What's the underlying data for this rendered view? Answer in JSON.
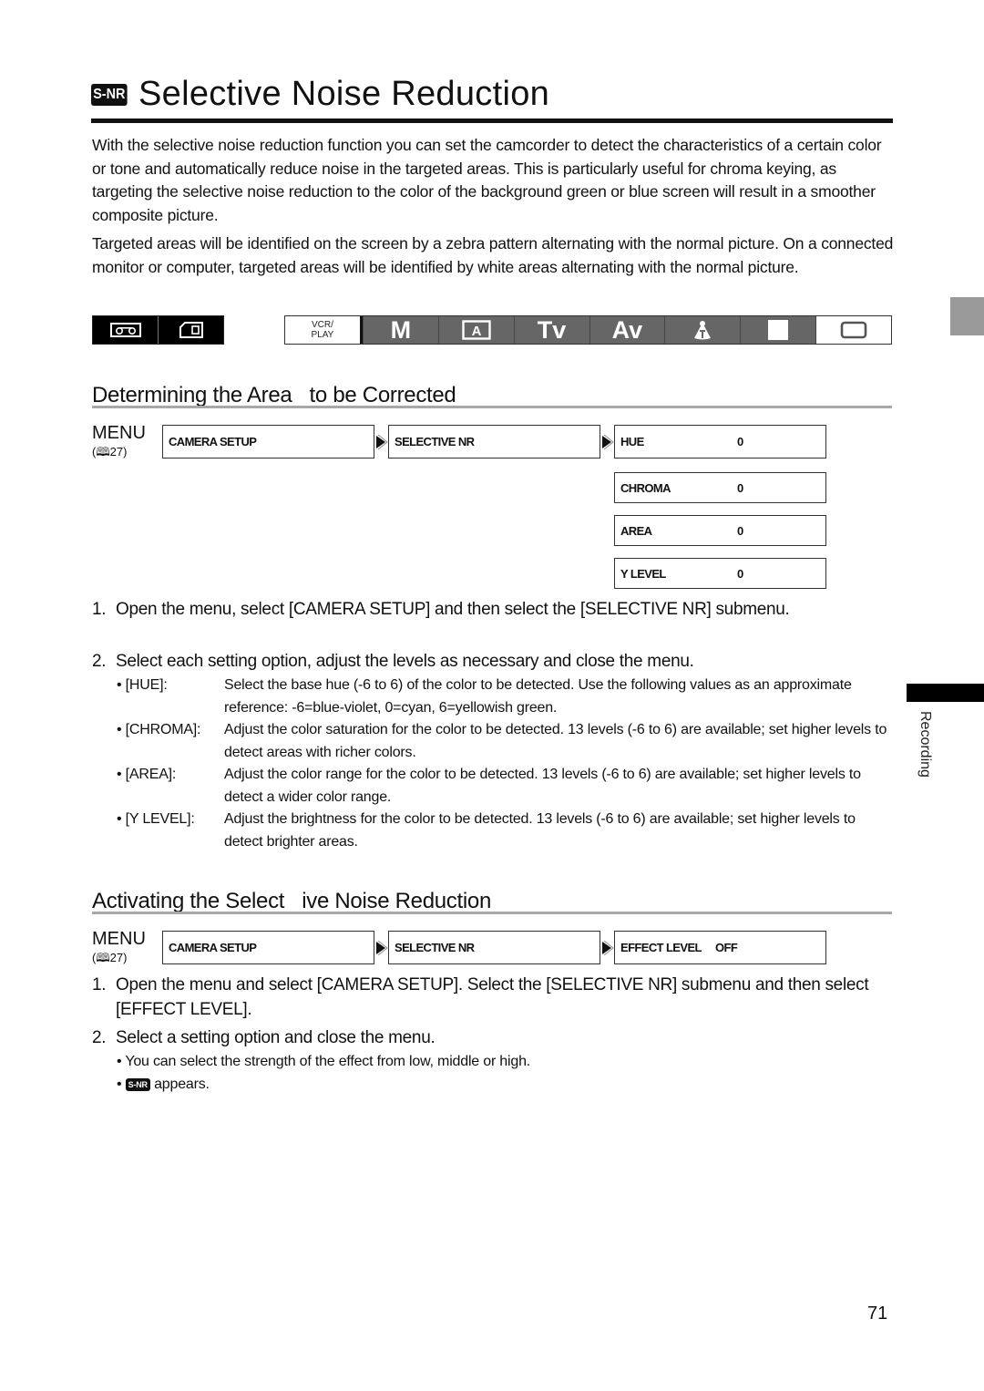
{
  "title": {
    "badge": "S-NR",
    "text": "Selective Noise Reduction"
  },
  "intro": [
    "With the selective noise reduction function you can set the camcorder to detect the characteristics of a certain color or tone and automatically reduce noise in the targeted areas. This is particularly useful for chroma keying, as targeting the selective noise reduction to the color of the background green or blue screen will result in a smoother composite picture.",
    "Targeted areas will be identified on the screen by a zebra pattern alternating with the normal picture. On a connected monitor or computer, targeted areas will be identified by white areas alternating with the normal picture."
  ],
  "media_modes": [
    {
      "icon": "tape-icon",
      "active": true
    },
    {
      "icon": "memory-card-icon",
      "active": true
    }
  ],
  "shooting_modes": [
    {
      "label": "VCR/\nPLAY",
      "line1": "VCR/",
      "line2": "PLAY",
      "active": false
    },
    {
      "label": "M",
      "active": true
    },
    {
      "label": "A",
      "icon": "auto-boxed-icon",
      "active": true
    },
    {
      "label": "Tv",
      "active": true
    },
    {
      "label": "Av",
      "active": true
    },
    {
      "label": "",
      "icon": "spotlight-icon",
      "active": true
    },
    {
      "label": "",
      "icon": "night-moon-icon",
      "active": true
    },
    {
      "label": "",
      "icon": "scene-frame-icon",
      "active": false
    }
  ],
  "side_tab": {
    "label": "Recording"
  },
  "section1": {
    "heading": "Determining the Area   to be Corrected",
    "menu_label": "MENU",
    "menu_ref": "27",
    "path": [
      "CAMERA SETUP",
      "SELECTIVE NR"
    ],
    "settings": [
      {
        "name": "HUE",
        "value": "0"
      },
      {
        "name": "CHROMA",
        "value": "0"
      },
      {
        "name": "AREA",
        "value": "0"
      },
      {
        "name": "Y LEVEL",
        "value": "0"
      }
    ],
    "steps": [
      {
        "num": "1.",
        "text": "Open the menu, select [CAMERA SETUP] and then select the [SELECTIVE NR] submenu."
      },
      {
        "num": "2.",
        "text": "Select each setting option, adjust the levels as necessary and close the menu."
      }
    ],
    "bullets": [
      {
        "label": "• [HUE]:",
        "text": "Select the base hue (-6 to 6) of the color to be detected. Use the following values as an approximate reference: -6=blue-violet, 0=cyan, 6=yellowish green."
      },
      {
        "label": "• [CHROMA]:",
        "text": "Adjust the color saturation for the color to be detected. 13 levels (-6 to 6) are available; set higher levels to detect areas with richer colors."
      },
      {
        "label": "• [AREA]:",
        "text": "Adjust the color range for the color to be detected. 13 levels (-6 to 6) are available; set higher levels to detect a wider color range."
      },
      {
        "label": "• [Y LEVEL]:",
        "text": "Adjust the brightness for the color to be detected. 13 levels (-6 to 6) are available; set higher levels to detect brighter areas."
      }
    ]
  },
  "section2": {
    "heading": "Activating the Select   ive Noise Reduction",
    "menu_label": "MENU",
    "menu_ref": "27",
    "path": [
      "CAMERA SETUP",
      "SELECTIVE NR"
    ],
    "setting": {
      "name": "EFFECT LEVEL",
      "value": "OFF"
    },
    "steps": [
      {
        "num": "1.",
        "text": "Open the menu and select [CAMERA SETUP]. Select the [SELECTIVE NR] submenu and then select [EFFECT LEVEL]."
      },
      {
        "num": "2.",
        "text": "Select a setting option and close the menu."
      }
    ],
    "bullets": [
      {
        "text": "You can select the strength of the effect from low, middle or high."
      },
      {
        "badge": "S-NR",
        "text": "appears."
      }
    ]
  },
  "page_number": "71"
}
